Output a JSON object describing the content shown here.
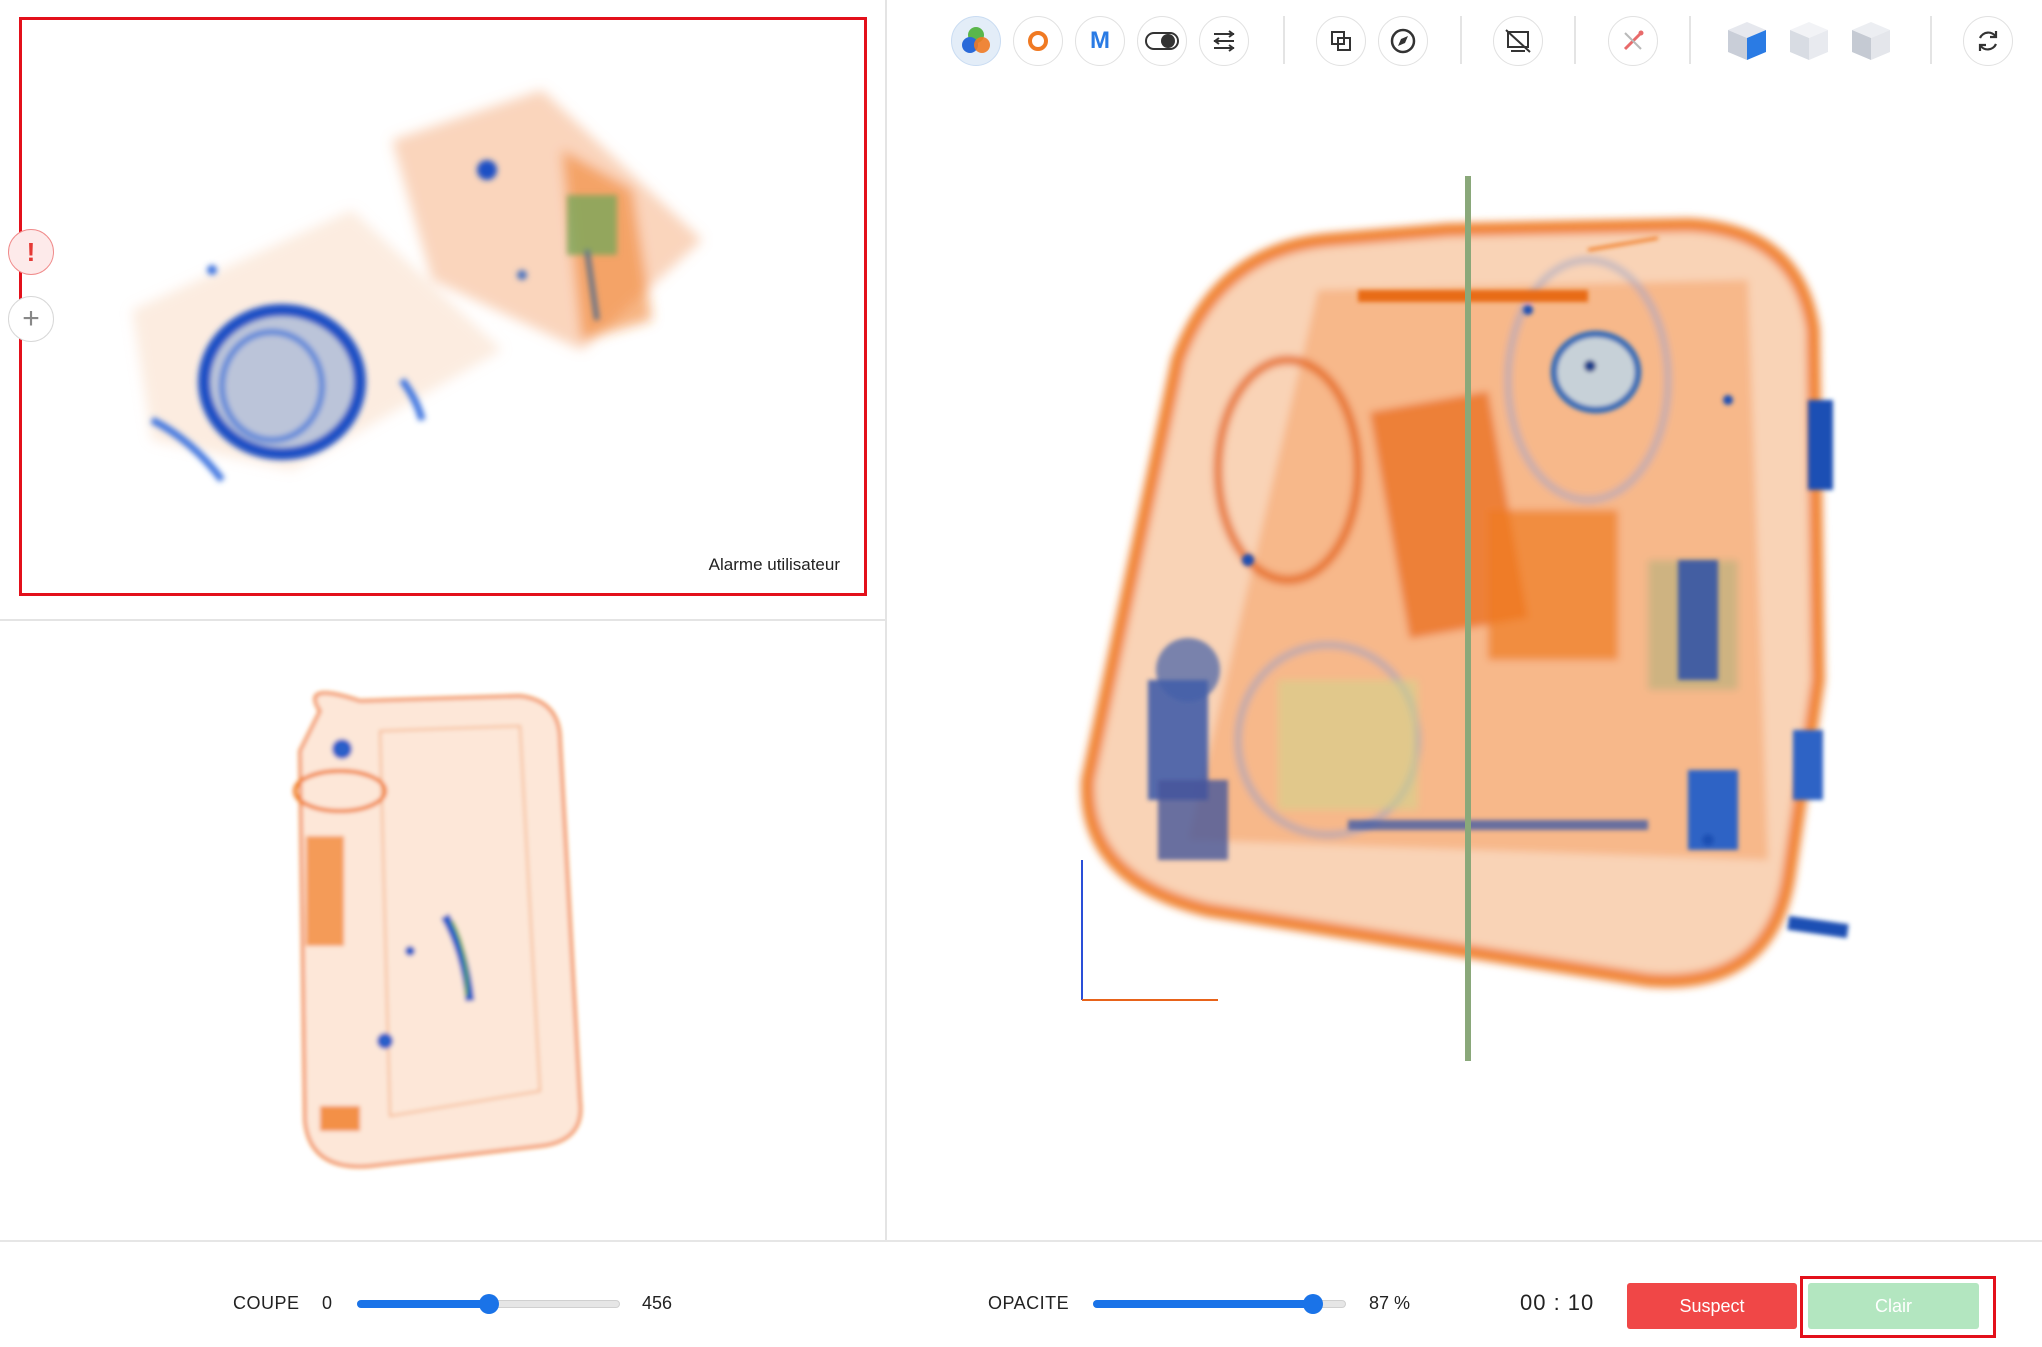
{
  "views": {
    "alarm_label": "Alarme utilisateur",
    "alert_symbol": "!",
    "add_symbol": "+"
  },
  "toolbar": {
    "tools": [
      {
        "name": "color-mode-icon",
        "active": true
      },
      {
        "name": "organic-filter-icon"
      },
      {
        "name": "metal-filter-icon",
        "label": "M"
      },
      {
        "name": "toggle-icon"
      },
      {
        "name": "adjust-sliders-icon"
      },
      {
        "name": "copy-layers-icon"
      },
      {
        "name": "compass-icon"
      },
      {
        "name": "crop-icon"
      },
      {
        "name": "measure-tool-icon"
      },
      {
        "name": "view-cube-front-icon"
      },
      {
        "name": "view-cube-top-icon"
      },
      {
        "name": "view-cube-side-icon"
      },
      {
        "name": "reset-rotation-icon"
      }
    ]
  },
  "controls": {
    "coupe": {
      "label": "COUPE",
      "min": "0",
      "max": "456",
      "value_fraction": 0.5
    },
    "opacite": {
      "label": "OPACITE",
      "value": "87 %",
      "value_fraction": 0.87
    },
    "timer": "00 : 10",
    "suspect_label": "Suspect",
    "clair_label": "Clair"
  },
  "colors": {
    "accent": "#1a73e8",
    "alarm_border": "#e3101b",
    "suspect": "#f04747",
    "clair": "#b3e6c0",
    "organic": "#f07a23",
    "inorganic": "#2a5fc9"
  }
}
